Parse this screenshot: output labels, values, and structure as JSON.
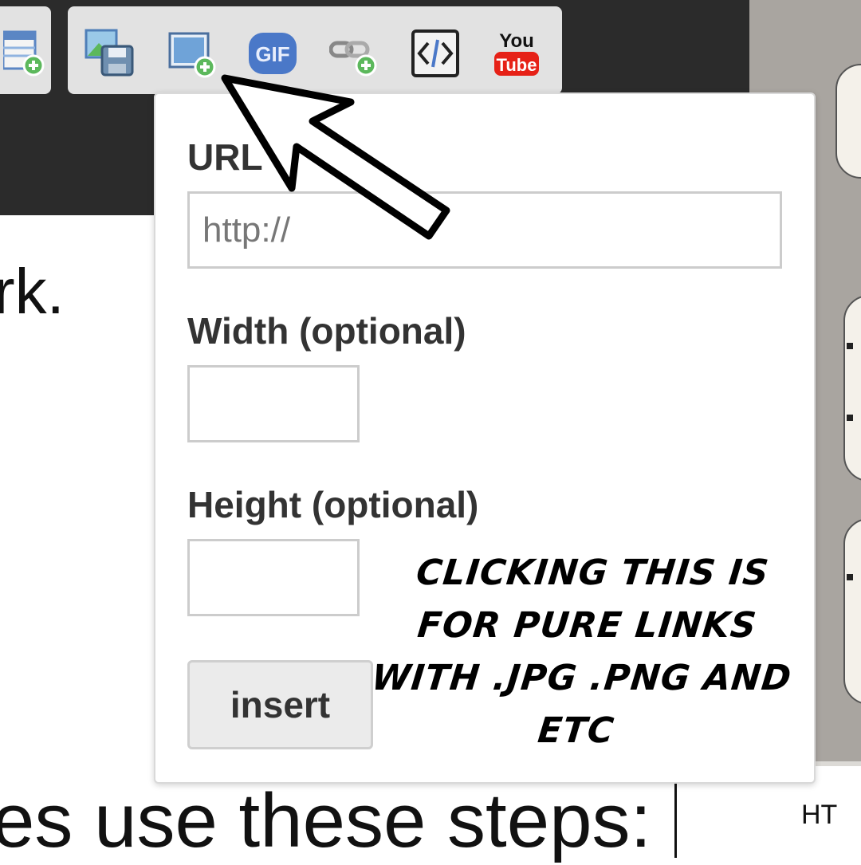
{
  "toolbar": {
    "buttons": [
      {
        "icon": "table-add-icon"
      },
      {
        "icon": "save-image-icon"
      },
      {
        "icon": "image-add-icon"
      },
      {
        "icon": "gif-icon",
        "label": "GIF"
      },
      {
        "icon": "link-add-icon"
      },
      {
        "icon": "code-embed-icon"
      },
      {
        "icon": "youtube-icon",
        "label_top": "You",
        "label_bottom": "Tube"
      }
    ]
  },
  "page": {
    "text_top": "rk.",
    "text_bottom": "es use these steps:"
  },
  "side_panel": {
    "text": "HT"
  },
  "popup": {
    "url_label": "URL",
    "url_placeholder": "http://",
    "url_value": "",
    "width_label": "Width (optional)",
    "width_value": "",
    "height_label": "Height (optional)",
    "height_value": "",
    "insert_label": "insert"
  },
  "annotation": {
    "text": "CLICKING THIS IS FOR PURE LINKS WITH .JPG .PNG AND ETC"
  },
  "colors": {
    "toolbar_bg": "#2b2b2b",
    "gif_blue": "#4a78c8",
    "youtube_red": "#e62117",
    "add_badge_green": "#5cb85c"
  }
}
